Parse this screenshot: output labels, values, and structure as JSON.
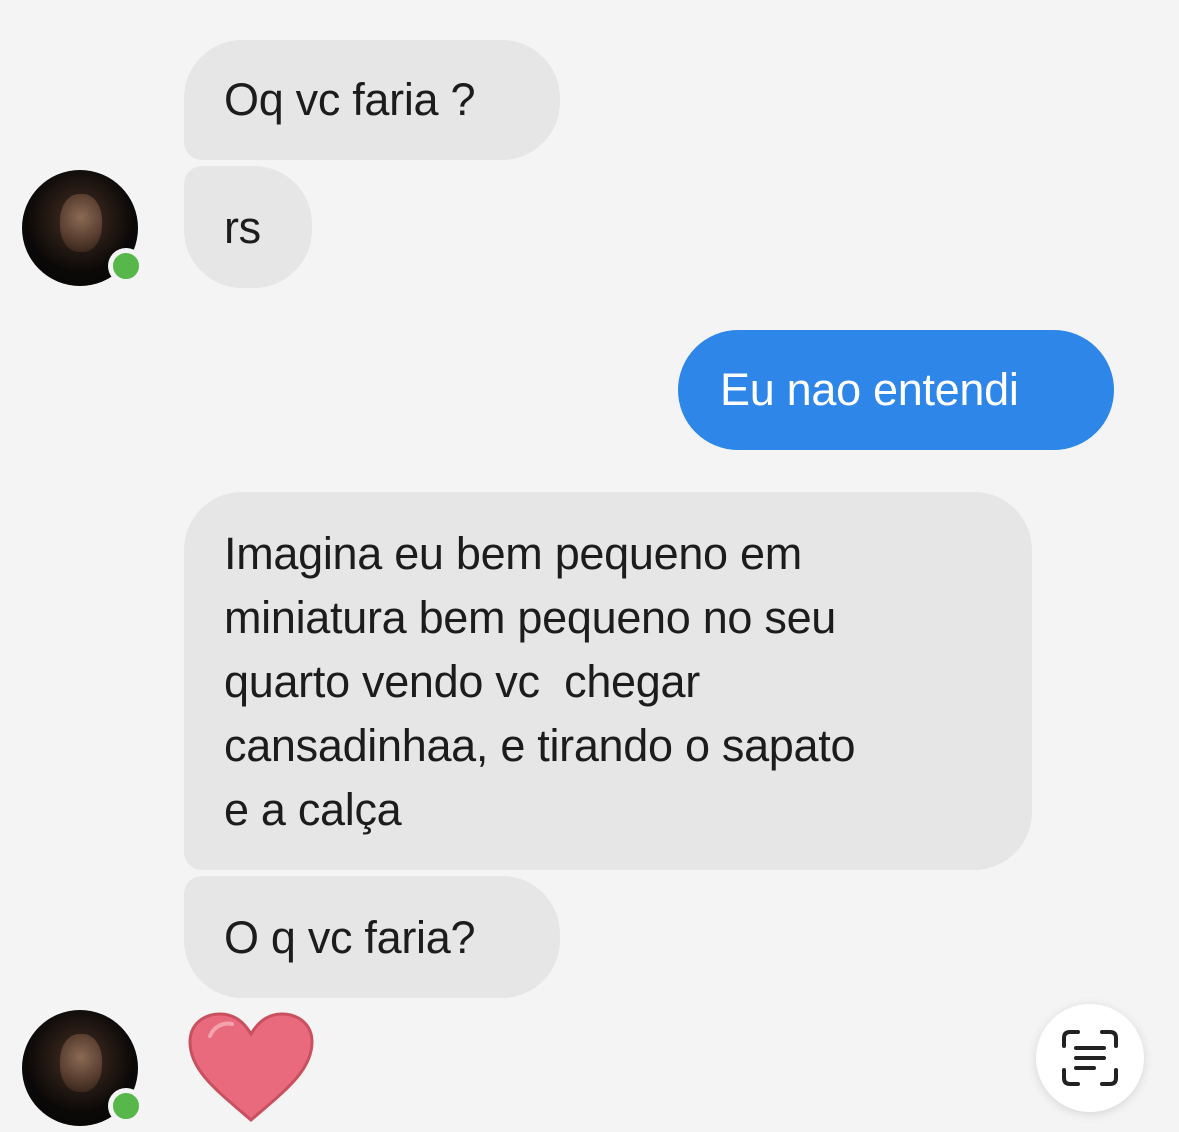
{
  "messages": [
    {
      "direction": "incoming",
      "text": "Oq vc faria ?"
    },
    {
      "direction": "incoming",
      "text": "rs"
    },
    {
      "direction": "outgoing",
      "text": "Eu nao entendi"
    },
    {
      "direction": "incoming",
      "lines": [
        "Imagina eu bem pequeno em",
        "miniatura bem pequeno no seu",
        "quarto vendo vc  chegar",
        "cansadinhaa, e tirando o sapato",
        "e a calça"
      ]
    },
    {
      "direction": "incoming",
      "text": "O q vc faria?"
    },
    {
      "direction": "incoming",
      "reaction": "heart-icon"
    }
  ],
  "colors": {
    "background": "#f4f4f4",
    "incoming_bubble": "#e6e6e6",
    "outgoing_bubble": "#2d86e8",
    "online_status": "#58b74a",
    "heart": "#e86a7c"
  },
  "icons": {
    "avatar_status": "online-dot",
    "scan_button": "text-scan-icon"
  }
}
